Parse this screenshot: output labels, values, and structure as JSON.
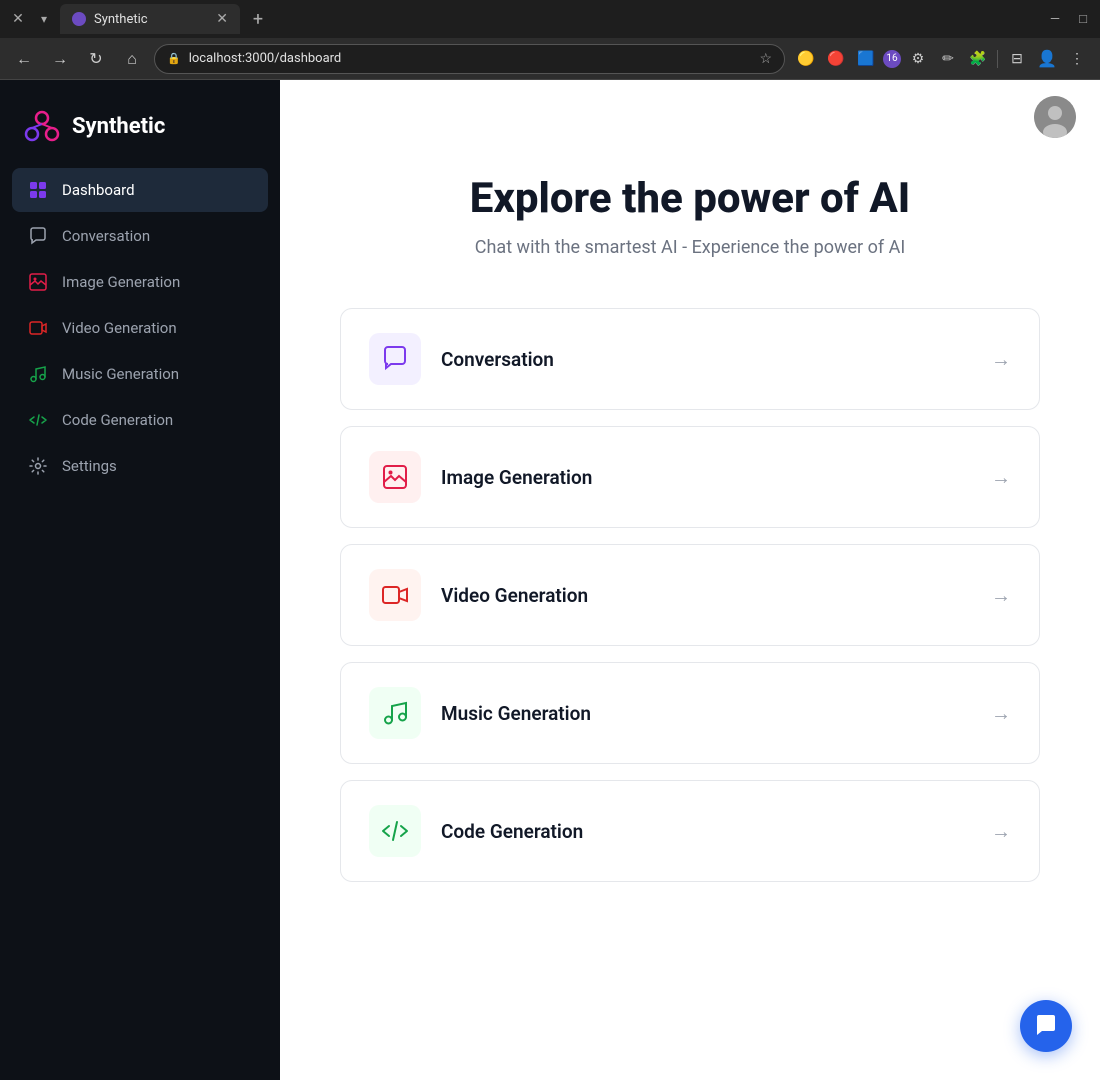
{
  "browser": {
    "tab_title": "Synthetic",
    "address": "localhost:3000/dashboard",
    "new_tab_label": "+",
    "close_label": "✕",
    "window_minimize": "—",
    "window_maximize": "□"
  },
  "sidebar": {
    "logo_text": "Synthetic",
    "items": [
      {
        "id": "dashboard",
        "label": "Dashboard",
        "active": true
      },
      {
        "id": "conversation",
        "label": "Conversation",
        "active": false
      },
      {
        "id": "image-generation",
        "label": "Image Generation",
        "active": false
      },
      {
        "id": "video-generation",
        "label": "Video Generation",
        "active": false
      },
      {
        "id": "music-generation",
        "label": "Music Generation",
        "active": false
      },
      {
        "id": "code-generation",
        "label": "Code Generation",
        "active": false
      },
      {
        "id": "settings",
        "label": "Settings",
        "active": false
      }
    ]
  },
  "main": {
    "hero_title": "Explore the power of AI",
    "hero_subtitle": "Chat with the smartest AI - Experience the power of AI",
    "cards": [
      {
        "id": "conversation",
        "label": "Conversation"
      },
      {
        "id": "image-generation",
        "label": "Image Generation"
      },
      {
        "id": "video-generation",
        "label": "Video Generation"
      },
      {
        "id": "music-generation",
        "label": "Music Generation"
      },
      {
        "id": "code-generation",
        "label": "Code Generation"
      }
    ]
  },
  "colors": {
    "sidebar_bg": "#0d1117",
    "active_item_bg": "#1e2a3a",
    "accent_blue": "#2563eb",
    "conversation_icon": "#7c3aed",
    "image_icon": "#e11d48",
    "video_icon": "#dc2626",
    "music_icon": "#16a34a",
    "code_icon": "#16a34a"
  }
}
